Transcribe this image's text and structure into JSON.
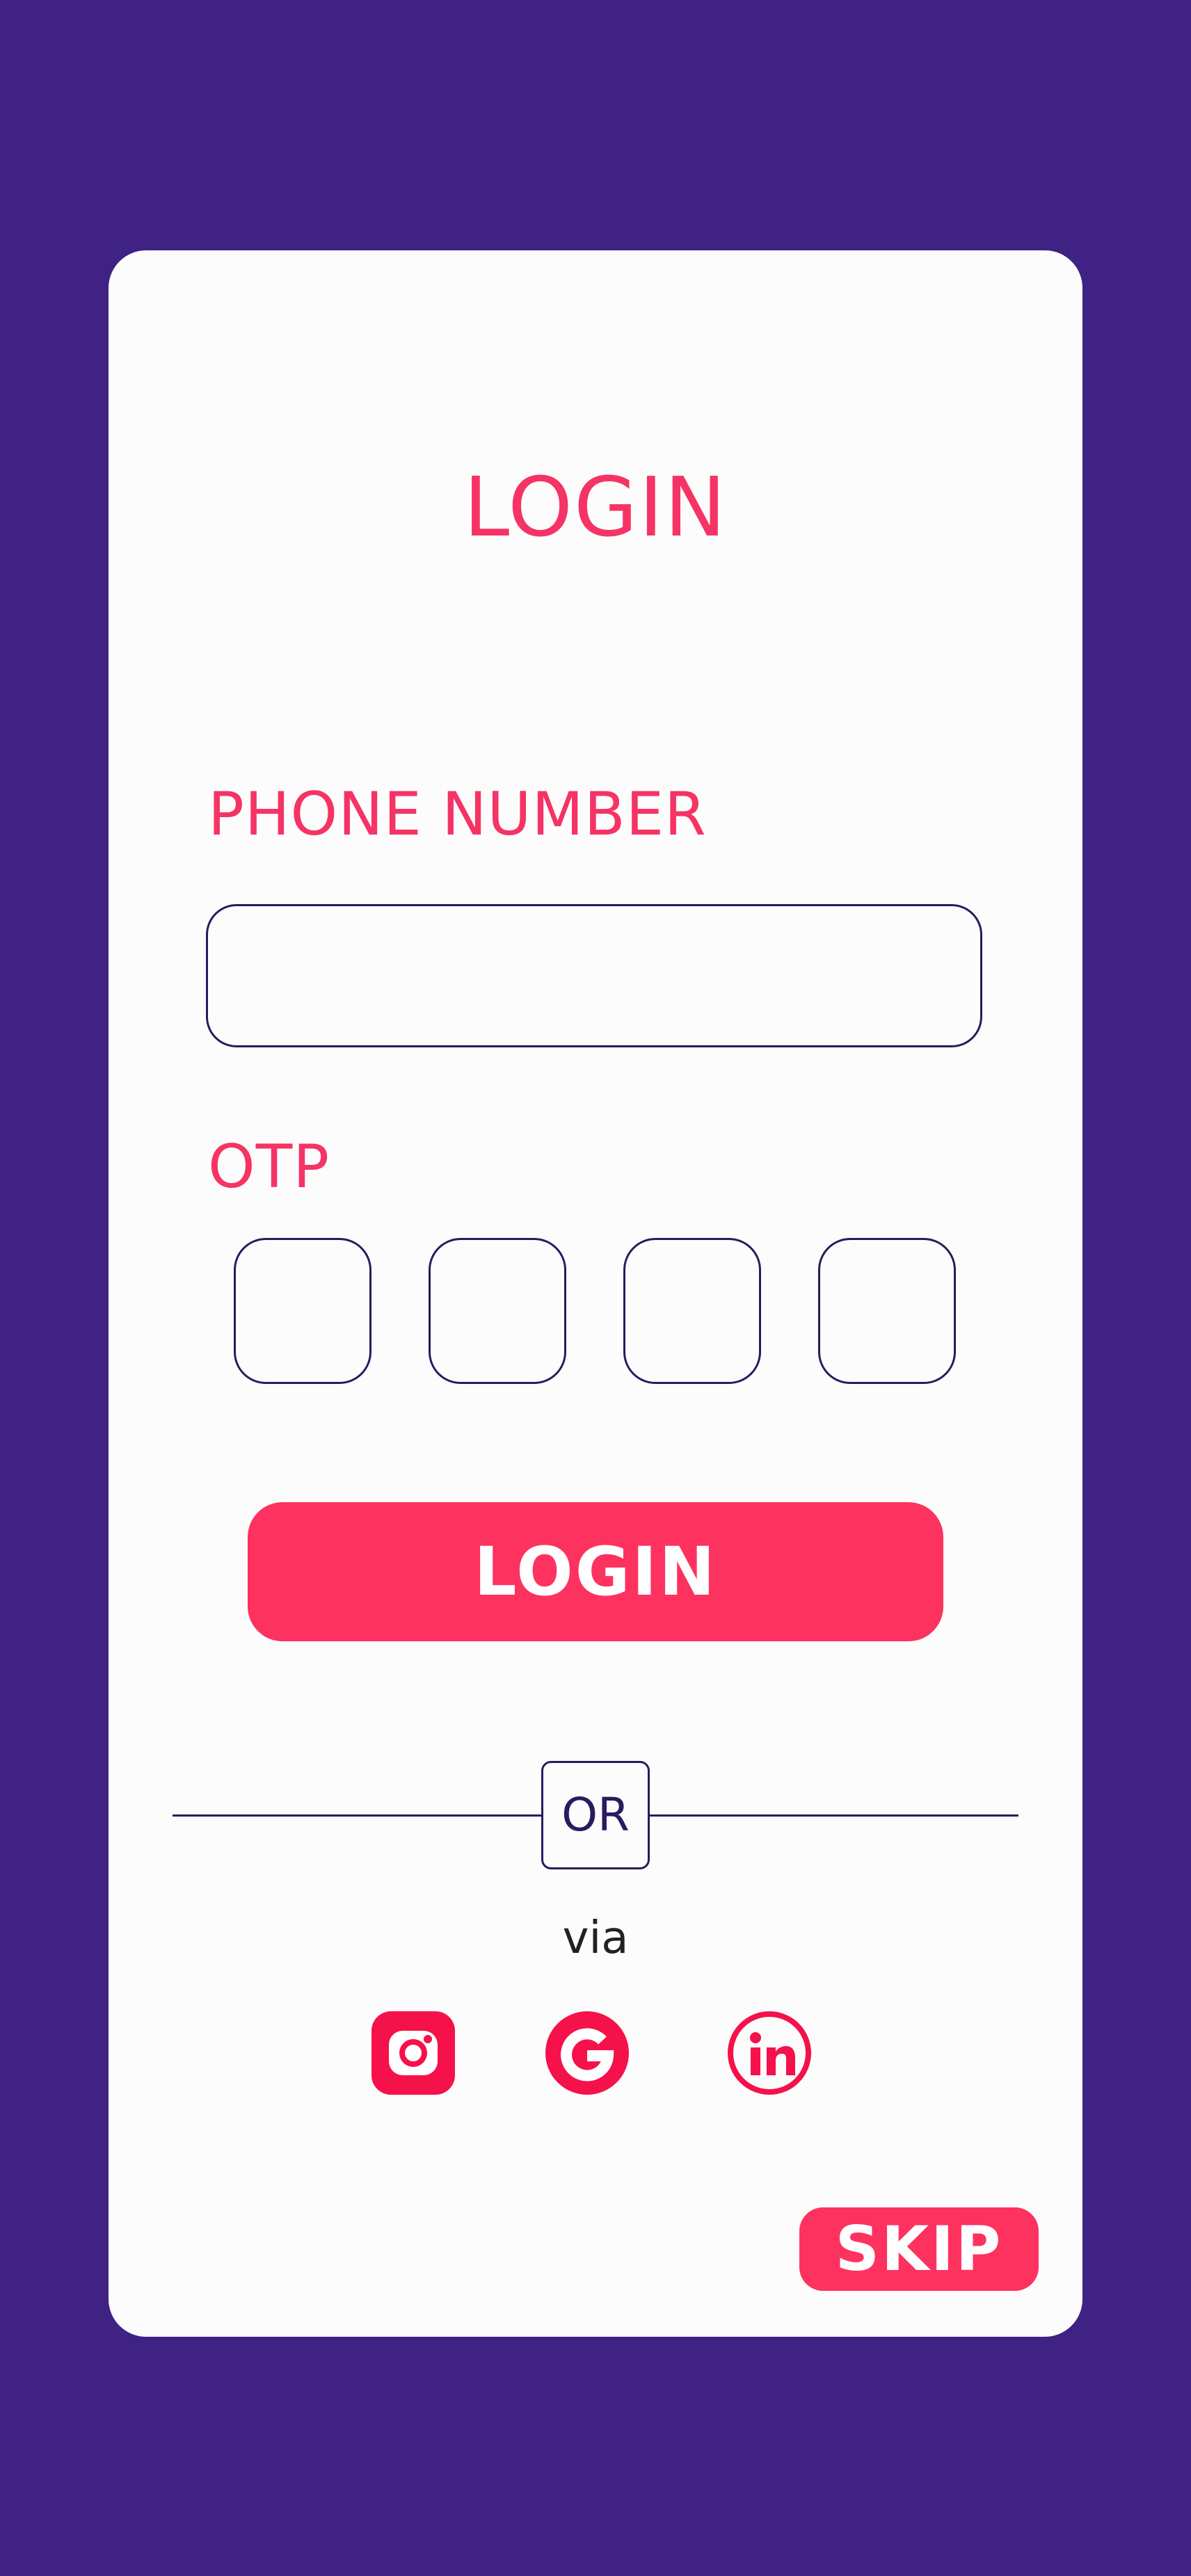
{
  "colors": {
    "background": "#3f2283",
    "card": "#fdfcfd",
    "accent": "#fe325f",
    "heading": "#f53365",
    "border": "#2a1a5e"
  },
  "login_form": {
    "title": "LOGIN",
    "phone": {
      "label": "PHONE NUMBER",
      "value": "",
      "placeholder": ""
    },
    "otp": {
      "label": "OTP",
      "digits": [
        "",
        "",
        "",
        ""
      ]
    },
    "login_button": "LOGIN",
    "divider_text": "OR",
    "via_text": "via",
    "social": [
      {
        "name": "Instagram",
        "icon": "instagram-icon"
      },
      {
        "name": "Google",
        "icon": "google-icon"
      },
      {
        "name": "LinkedIn",
        "icon": "linkedin-icon"
      }
    ],
    "skip_button": "SKIP"
  }
}
